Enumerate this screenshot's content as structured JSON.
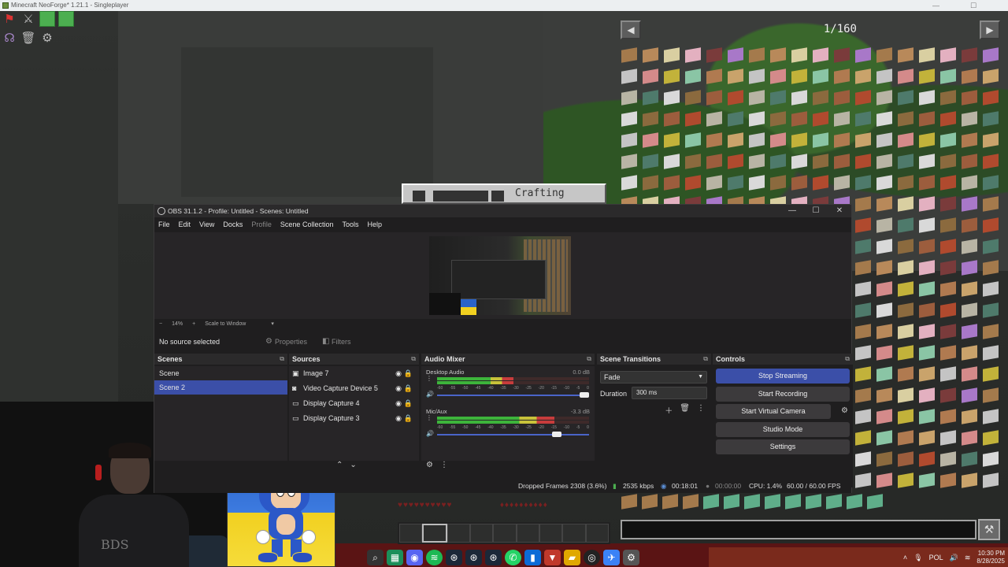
{
  "minecraft": {
    "window_title": "Minecraft NeoForge* 1.21.1 - Singleplayer",
    "jei_page": "1/160",
    "crafting_label": "Crafting"
  },
  "obs": {
    "window_title": "OBS 31.1.2 - Profile: Untitled - Scenes: Untitled",
    "menu": [
      "File",
      "Edit",
      "View",
      "Docks",
      "Profile",
      "Scene Collection",
      "Tools",
      "Help"
    ],
    "zoom": {
      "percent": "14%",
      "scale_mode": "Scale to Window"
    },
    "source_bar": {
      "status": "No source selected",
      "properties": "Properties",
      "filters": "Filters"
    },
    "scenes": {
      "title": "Scenes",
      "items": [
        "Scene",
        "Scene 2"
      ],
      "active": "Scene 2"
    },
    "sources": {
      "title": "Sources",
      "items": [
        "Image 7",
        "Video Capture Device 5",
        "Display Capture 4",
        "Display Capture 3"
      ]
    },
    "audio_mixer": {
      "title": "Audio Mixer",
      "channels": [
        {
          "name": "Desktop Audio",
          "db": "0.0 dB",
          "level": 0.5,
          "volume": 1.0
        },
        {
          "name": "Mic/Aux",
          "db": "-3.3 dB",
          "level": 0.77,
          "volume": 0.82
        }
      ],
      "scale": [
        "-60",
        "-55",
        "-50",
        "-45",
        "-40",
        "-35",
        "-30",
        "-25",
        "-20",
        "-15",
        "-10",
        "-5",
        "0"
      ]
    },
    "transitions": {
      "title": "Scene Transitions",
      "type": "Fade",
      "duration_label": "Duration",
      "duration": "300 ms"
    },
    "controls": {
      "title": "Controls",
      "stop_streaming": "Stop Streaming",
      "start_recording": "Start Recording",
      "start_virtual_camera": "Start Virtual Camera",
      "studio_mode": "Studio Mode",
      "settings": "Settings"
    },
    "status": {
      "dropped_frames": "Dropped Frames 2308 (3.6%)",
      "bitrate": "2535 kbps",
      "stream_time": "00:18:01",
      "record_time": "00:00:00",
      "cpu": "CPU: 1.4%",
      "fps": "60.00 / 60.00 FPS"
    }
  },
  "webcam": {
    "shirt_text": "BDS"
  },
  "taskbar": {
    "language": "POL",
    "time": "10:30 PM",
    "date": "8/28/2025"
  },
  "colors": {
    "accent": "#3b4fa8",
    "obs_bg": "#1f1e1f",
    "obs_panel": "#272527"
  }
}
